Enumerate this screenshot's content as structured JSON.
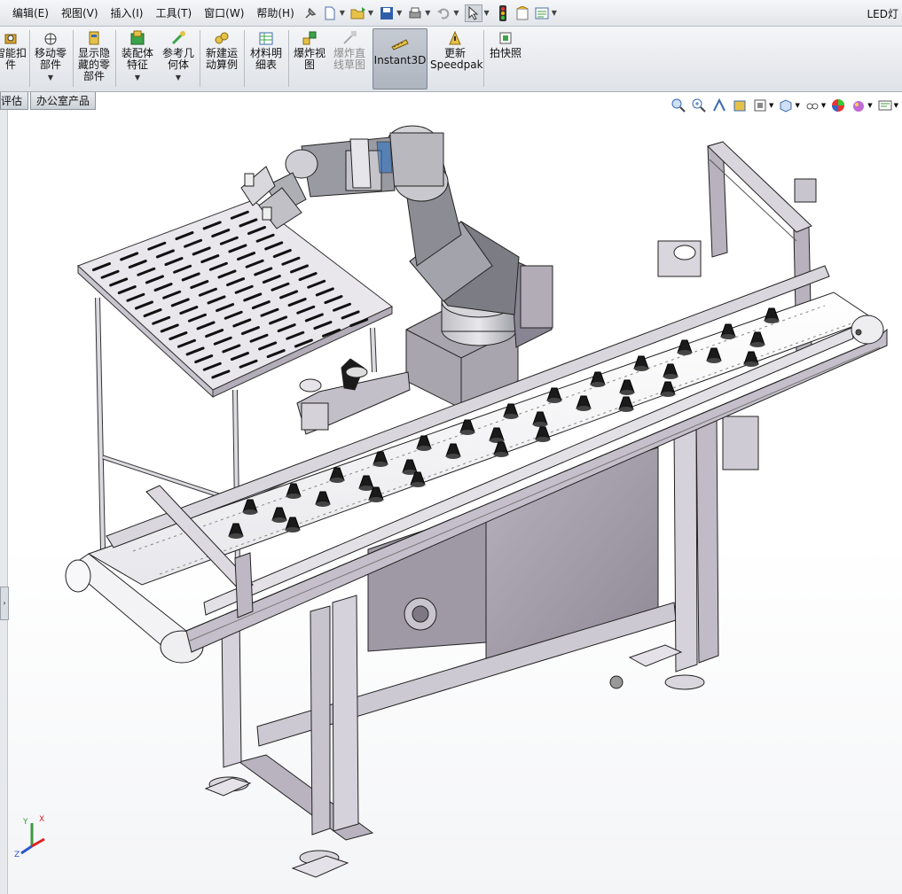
{
  "menu": [
    "编辑(E)",
    "视图(V)",
    "插入(I)",
    "工具(T)",
    "窗口(W)",
    "帮助(H)"
  ],
  "document_title": "LED灯",
  "ribbon": {
    "smart_fastener": "智能扣件",
    "move_component": "移动零部件",
    "show_hidden": "显示隐藏的零部件",
    "assembly_features": "装配体特征",
    "reference_geometry": "参考几何体",
    "new_motion_study": "新建运动算例",
    "bom": "材料明细表",
    "exploded_view": "爆炸视图",
    "explode_line_sketch": "爆炸直线草图",
    "instant3d": "Instant3D",
    "update_speedpak": "更新Speedpak",
    "take_snapshot": "拍快照"
  },
  "tabs": [
    "评估",
    "办公室产品"
  ],
  "triad": {
    "y": "Y",
    "x": "X",
    "z": "Z"
  },
  "colors": {
    "steel": "#b9b5bf",
    "steel_dark": "#8a8593",
    "steel_light": "#dcd9e0",
    "belt": "#f1f1f3",
    "cone": "#1a1a1a",
    "panel": "#a49ea9",
    "accent_blue": "#2b6fbf"
  }
}
